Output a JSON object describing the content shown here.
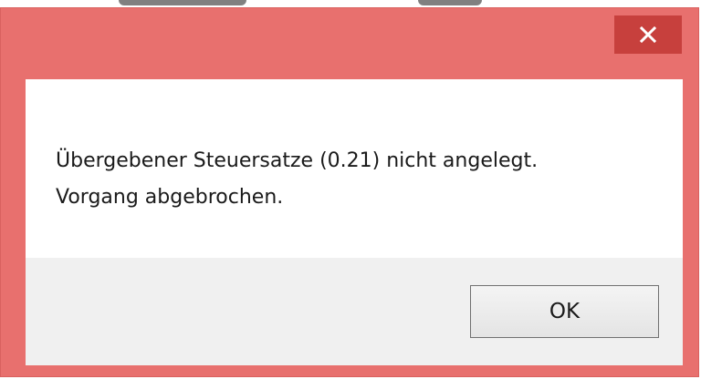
{
  "dialog": {
    "message_line1": "Übergebener Steuersatze (0.21) nicht angelegt.",
    "message_line2": "Vorgang abgebrochen.",
    "ok_label": "OK",
    "close_icon": "close-icon"
  },
  "colors": {
    "titlebar": "#e8706e",
    "close_button": "#c7403d",
    "client_background": "#ffffff",
    "footer_background": "#f0f0f0"
  }
}
